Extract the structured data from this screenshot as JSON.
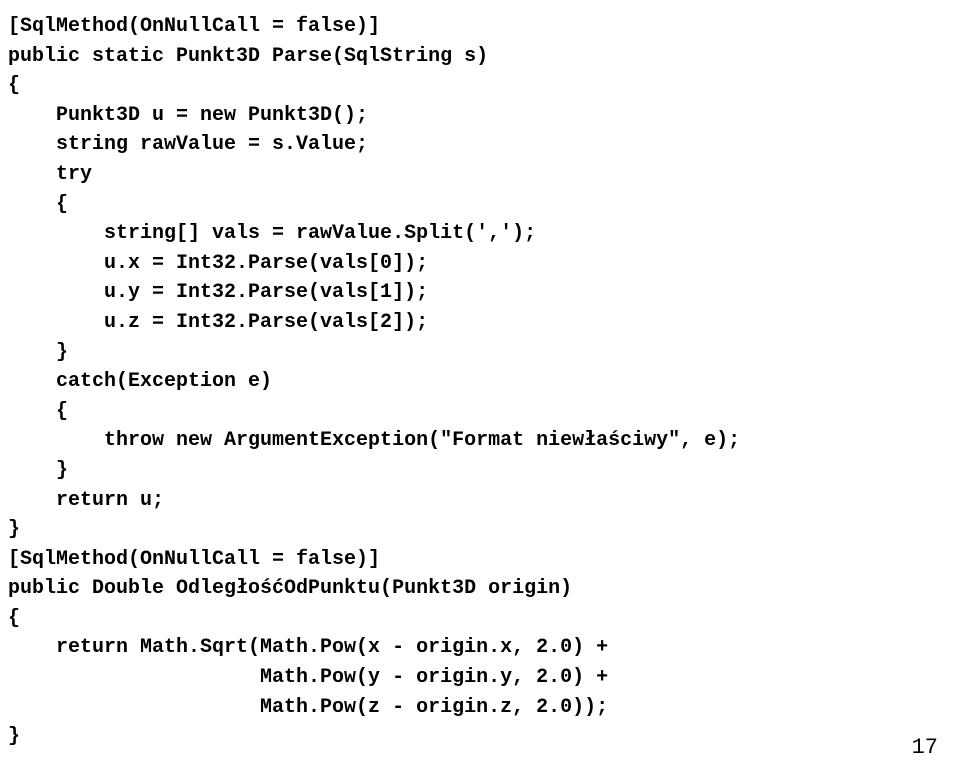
{
  "code": {
    "line1": "[SqlMethod(OnNullCall = false)]",
    "line2": "public static Punkt3D Parse(SqlString s)",
    "line3": "{",
    "line4": "    Punkt3D u = new Punkt3D();",
    "line5": "    string rawValue = s.Value;",
    "line6": "    try",
    "line7": "    {",
    "line8": "        string[] vals = rawValue.Split(',');",
    "line9": "        u.x = Int32.Parse(vals[0]);",
    "line10": "        u.y = Int32.Parse(vals[1]);",
    "line11": "        u.z = Int32.Parse(vals[2]);",
    "line12": "    }",
    "line13": "    catch(Exception e)",
    "line14": "    {",
    "line15": "        throw new ArgumentException(\"Format niewłaściwy\", e);",
    "line16": "    }",
    "line17": "    return u;",
    "line18": "}",
    "line19": "[SqlMethod(OnNullCall = false)]",
    "line20": "public Double OdległośćOdPunktu(Punkt3D origin)",
    "line21": "{",
    "line22": "    return Math.Sqrt(Math.Pow(x - origin.x, 2.0) +",
    "line23": "                     Math.Pow(y - origin.y, 2.0) +",
    "line24": "                     Math.Pow(z - origin.z, 2.0));",
    "line25": "}"
  },
  "page_number": "17"
}
